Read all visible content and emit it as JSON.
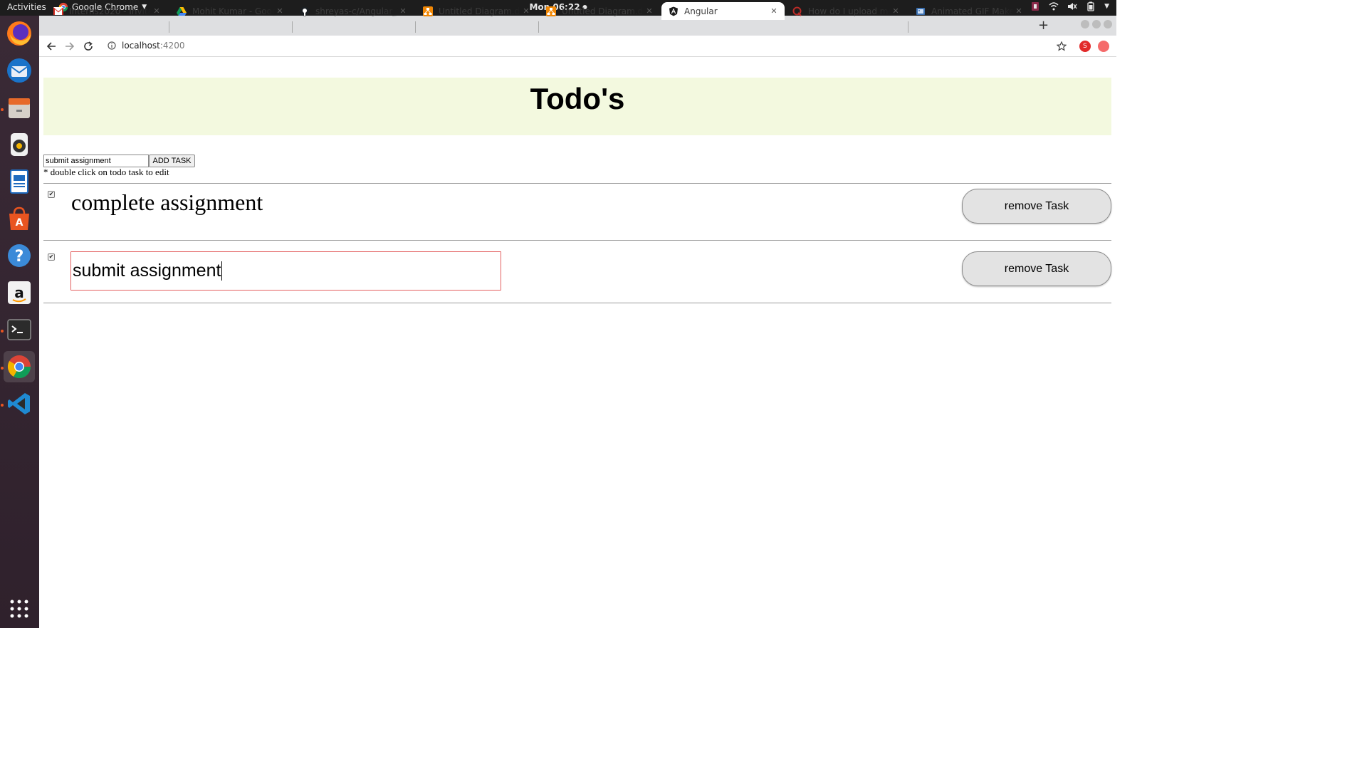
{
  "system_bar": {
    "activities": "Activities",
    "app_name": "Google Chrome",
    "clock": "Mon 06:22"
  },
  "dock": {
    "apps": [
      "firefox-icon",
      "thunderbird-icon",
      "files-icon",
      "rhythmbox-icon",
      "writer-icon",
      "software-center-icon",
      "help-icon",
      "amazon-icon",
      "terminal-icon",
      "chrome-icon",
      "vscode-icon",
      "app-grid-icon"
    ],
    "active_app": "chrome-icon"
  },
  "browser": {
    "tabs": [
      {
        "label": "Interns2020 - Invitatio",
        "icon": "gmail-icon"
      },
      {
        "label": "Mohit Kumar - Google",
        "icon": "google-drive-icon"
      },
      {
        "label": "shreyas-c/Angular_to",
        "icon": "github-icon"
      },
      {
        "label": "Untitled Diagram.dra",
        "icon": "drawio-icon"
      },
      {
        "label": "Untitled Diagram.dra",
        "icon": "drawio-icon"
      },
      {
        "label": "Angular",
        "icon": "angular-icon",
        "active": true
      },
      {
        "label": "How do I upload mor",
        "icon": "quora-icon"
      },
      {
        "label": "Animated GIF Maker",
        "icon": "gif-maker-icon"
      }
    ],
    "url_host": "localhost",
    "url_port": ":4200",
    "extension_badge": "S"
  },
  "app": {
    "title": "Todo's",
    "new_task_value": "submit assignment",
    "add_button_label": "ADD TASK",
    "hint": "* double click on todo task to edit",
    "tasks": [
      {
        "text": "complete assignment",
        "checked": true,
        "editing": false,
        "remove_label": "remove Task"
      },
      {
        "text": "submit assignment",
        "checked": true,
        "editing": true,
        "remove_label": "remove Task"
      }
    ]
  },
  "colors": {
    "banner_bg": "#f3f9df",
    "edit_border": "#e36060",
    "dock_bg": "#2f212c",
    "ubuntu_orange": "#e95420"
  }
}
